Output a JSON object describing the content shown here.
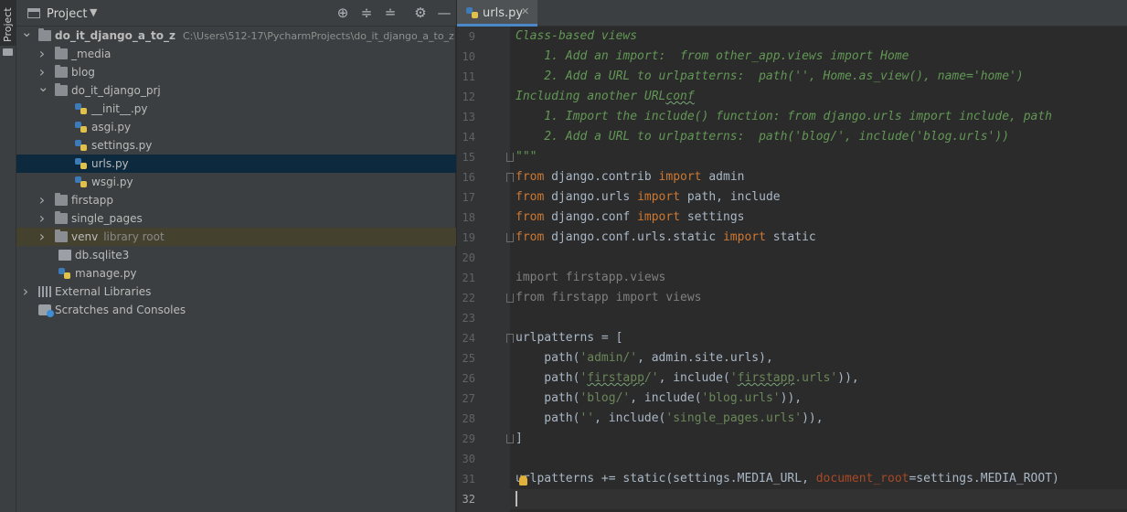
{
  "tool_strip": {
    "project_tab": "Project",
    "folder_icon": "folder-icon"
  },
  "project_panel": {
    "title": "Project",
    "icons": [
      "locate-icon",
      "expand-all-icon",
      "collapse-all-icon",
      "gear-icon",
      "minimize-icon"
    ],
    "tree": [
      {
        "label": "do_it_django_a_to_z",
        "path": "C:\\Users\\512-17\\PycharmProjects\\do_it_django_a_to_z",
        "type": "folder",
        "expanded": true,
        "depth": 0
      },
      {
        "label": "_media",
        "type": "folder",
        "expanded": false,
        "depth": 1
      },
      {
        "label": "blog",
        "type": "folder",
        "expanded": false,
        "depth": 1
      },
      {
        "label": "do_it_django_prj",
        "type": "folder",
        "expanded": true,
        "depth": 1
      },
      {
        "label": "__init__.py",
        "type": "python",
        "depth": 2
      },
      {
        "label": "asgi.py",
        "type": "python",
        "depth": 2
      },
      {
        "label": "settings.py",
        "type": "python",
        "depth": 2
      },
      {
        "label": "urls.py",
        "type": "python",
        "depth": 2,
        "selected": true
      },
      {
        "label": "wsgi.py",
        "type": "python",
        "depth": 2
      },
      {
        "label": "firstapp",
        "type": "folder",
        "expanded": false,
        "depth": 1
      },
      {
        "label": "single_pages",
        "type": "folder",
        "expanded": false,
        "depth": 1
      },
      {
        "label": "venv",
        "sub": "library root",
        "type": "folder",
        "expanded": false,
        "depth": 1,
        "excluded": true
      },
      {
        "label": "db.sqlite3",
        "type": "db",
        "depth": 1
      },
      {
        "label": "manage.py",
        "type": "python",
        "depth": 1
      },
      {
        "label": "External Libraries",
        "type": "library",
        "expanded": false,
        "depth": 0
      },
      {
        "label": "Scratches and Consoles",
        "type": "scratch",
        "depth": 0
      }
    ]
  },
  "editor": {
    "active_tab": "urls.py",
    "current_line": 32,
    "lines": [
      {
        "n": "9",
        "code": "Class-based views"
      },
      {
        "n": "10",
        "code": "    1. Add an import:  from other_app.views import Home"
      },
      {
        "n": "11",
        "code": "    2. Add a URL to urlpatterns:  path('', Home.as_view(), name='home')"
      },
      {
        "n": "12",
        "code": "Including another URLconf"
      },
      {
        "n": "13",
        "code": "    1. Import the include() function: from django.urls import include, path"
      },
      {
        "n": "14",
        "code": "    2. Add a URL to urlpatterns:  path('blog/', include('blog.urls'))"
      },
      {
        "n": "15",
        "code": "\"\"\""
      },
      {
        "n": "16",
        "code": "from django.contrib import admin"
      },
      {
        "n": "17",
        "code": "from django.urls import path, include"
      },
      {
        "n": "18",
        "code": "from django.conf import settings"
      },
      {
        "n": "19",
        "code": "from django.conf.urls.static import static"
      },
      {
        "n": "20",
        "code": ""
      },
      {
        "n": "21",
        "code": "import firstapp.views"
      },
      {
        "n": "22",
        "code": "from firstapp import views"
      },
      {
        "n": "23",
        "code": ""
      },
      {
        "n": "24",
        "code": "urlpatterns = ["
      },
      {
        "n": "25",
        "code": "    path('admin/', admin.site.urls),"
      },
      {
        "n": "26",
        "code": "    path('firstapp/', include('firstapp.urls')),"
      },
      {
        "n": "27",
        "code": "    path('blog/', include('blog.urls')),"
      },
      {
        "n": "28",
        "code": "    path('', include('single_pages.urls')),"
      },
      {
        "n": "29",
        "code": "]"
      },
      {
        "n": "30",
        "code": ""
      },
      {
        "n": "31",
        "code": "urlpatterns += static(settings.MEDIA_URL, document_root=settings.MEDIA_ROOT)"
      },
      {
        "n": "32",
        "code": ""
      }
    ]
  },
  "colors": {
    "docstring": "#629755",
    "keyword": "#cc7832",
    "string": "#6a8759",
    "unused": "#7f7f7f",
    "param": "#aa4926",
    "default": "#a9b7c6",
    "selection": "#0d293e",
    "excluded": "#45412f",
    "tab_accent": "#4a88c7"
  }
}
